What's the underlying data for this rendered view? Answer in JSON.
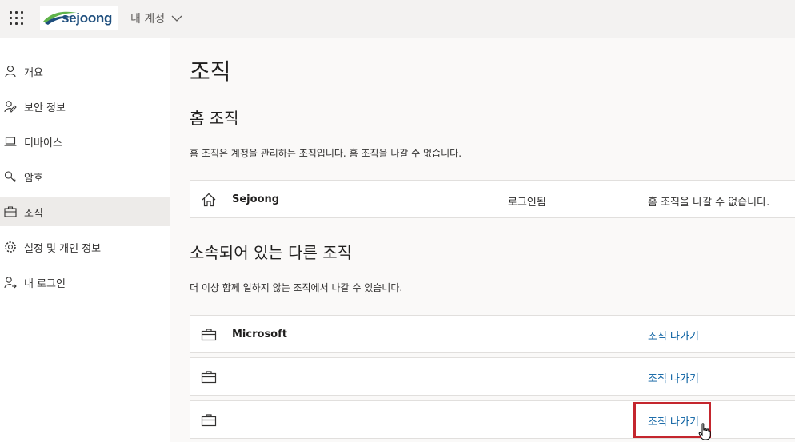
{
  "header": {
    "brand": "sejoong",
    "account_menu": "내 계정"
  },
  "sidebar": {
    "items": [
      {
        "label": "개요",
        "icon": "person-icon"
      },
      {
        "label": "보안 정보",
        "icon": "security-info-icon"
      },
      {
        "label": "디바이스",
        "icon": "laptop-icon"
      },
      {
        "label": "암호",
        "icon": "key-icon"
      },
      {
        "label": "조직",
        "icon": "briefcase-icon",
        "active": true
      },
      {
        "label": "설정 및 개인 정보",
        "icon": "gear-icon"
      },
      {
        "label": "내 로그인",
        "icon": "sign-in-icon"
      }
    ]
  },
  "main": {
    "title": "조직",
    "home": {
      "heading": "홈 조직",
      "description": "홈 조직은 계정을 관리하는 조직입니다. 홈 조직을 나갈 수 없습니다.",
      "org_name": "Sejoong",
      "status": "로그인됨",
      "note": "홈 조직을 나갈 수 없습니다."
    },
    "others": {
      "heading": "소속되어 있는 다른 조직",
      "description": "더 이상 함께 일하지 않는 조직에서 나갈 수 있습니다.",
      "orgs": [
        {
          "name": "Microsoft",
          "action": "조직 나가기"
        },
        {
          "name": "",
          "action": "조직 나가기"
        },
        {
          "name": "",
          "action": "조직 나가기"
        }
      ]
    }
  },
  "colors": {
    "link": "#005a9e",
    "highlight_border": "#c4262e",
    "active_nav": "#edebe9"
  }
}
